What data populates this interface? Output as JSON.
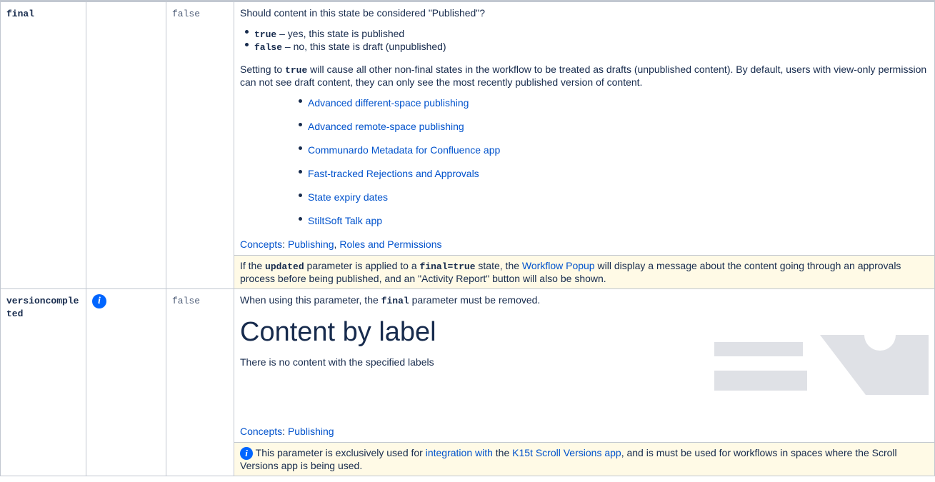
{
  "rows": [
    {
      "name": "final",
      "default": "false",
      "question": "Should content in this state be considered \"Published\"?",
      "options": [
        {
          "code": "true",
          "text": " – yes, this state is published"
        },
        {
          "code": "false",
          "text": " – no, this state is draft (unpublished)"
        }
      ],
      "setting": {
        "pre": "Setting to ",
        "code": "true",
        "post": " will cause all other non-final states in the workflow to be treated as drafts (unpublished content). By default, users with view-only permission can not see draft content, they can only see the most recently published version of content."
      },
      "related_links": [
        "Advanced different-space publishing",
        "Advanced remote-space publishing",
        "Communardo Metadata for Confluence app",
        "Fast-tracked Rejections and Approvals",
        "State expiry dates",
        "StiltSoft Talk app"
      ],
      "concepts": {
        "label": "Concepts",
        "sep": ": ",
        "comma": ", ",
        "links": [
          "Publishing",
          "Roles and Permissions"
        ]
      },
      "note": {
        "t1": "If the ",
        "c1": "updated",
        "t2": " parameter is applied to a ",
        "c2": "final=true",
        "t3": " state, the ",
        "link": "Workflow Popup",
        "t4": " will display a message about the content going through an approvals process before being published, and an \"Activity Report\" button will also be shown."
      }
    },
    {
      "name": "versioncompleted",
      "icon": "info-icon",
      "default": "false",
      "first": {
        "pre": "When using this parameter, the ",
        "code": "final",
        "post": " parameter must be removed."
      },
      "cbl_title": "Content by label",
      "cbl_empty": "There is no content with the specified labels",
      "concepts": {
        "label": "Concepts",
        "sep": ": ",
        "links": [
          "Publishing"
        ]
      },
      "note": {
        "t1": " This parameter is exclusively used for ",
        "link1": "integration with",
        "t2": " the ",
        "link2": "K15t Scroll Versions app",
        "t3": ", and is must be used for workflows in spaces where the Scroll Versions app is being used."
      }
    }
  ],
  "colors": {
    "link": "#0052cc",
    "note_bg": "#fffae6",
    "info": "#0065ff",
    "border": "#c1c7d0"
  }
}
